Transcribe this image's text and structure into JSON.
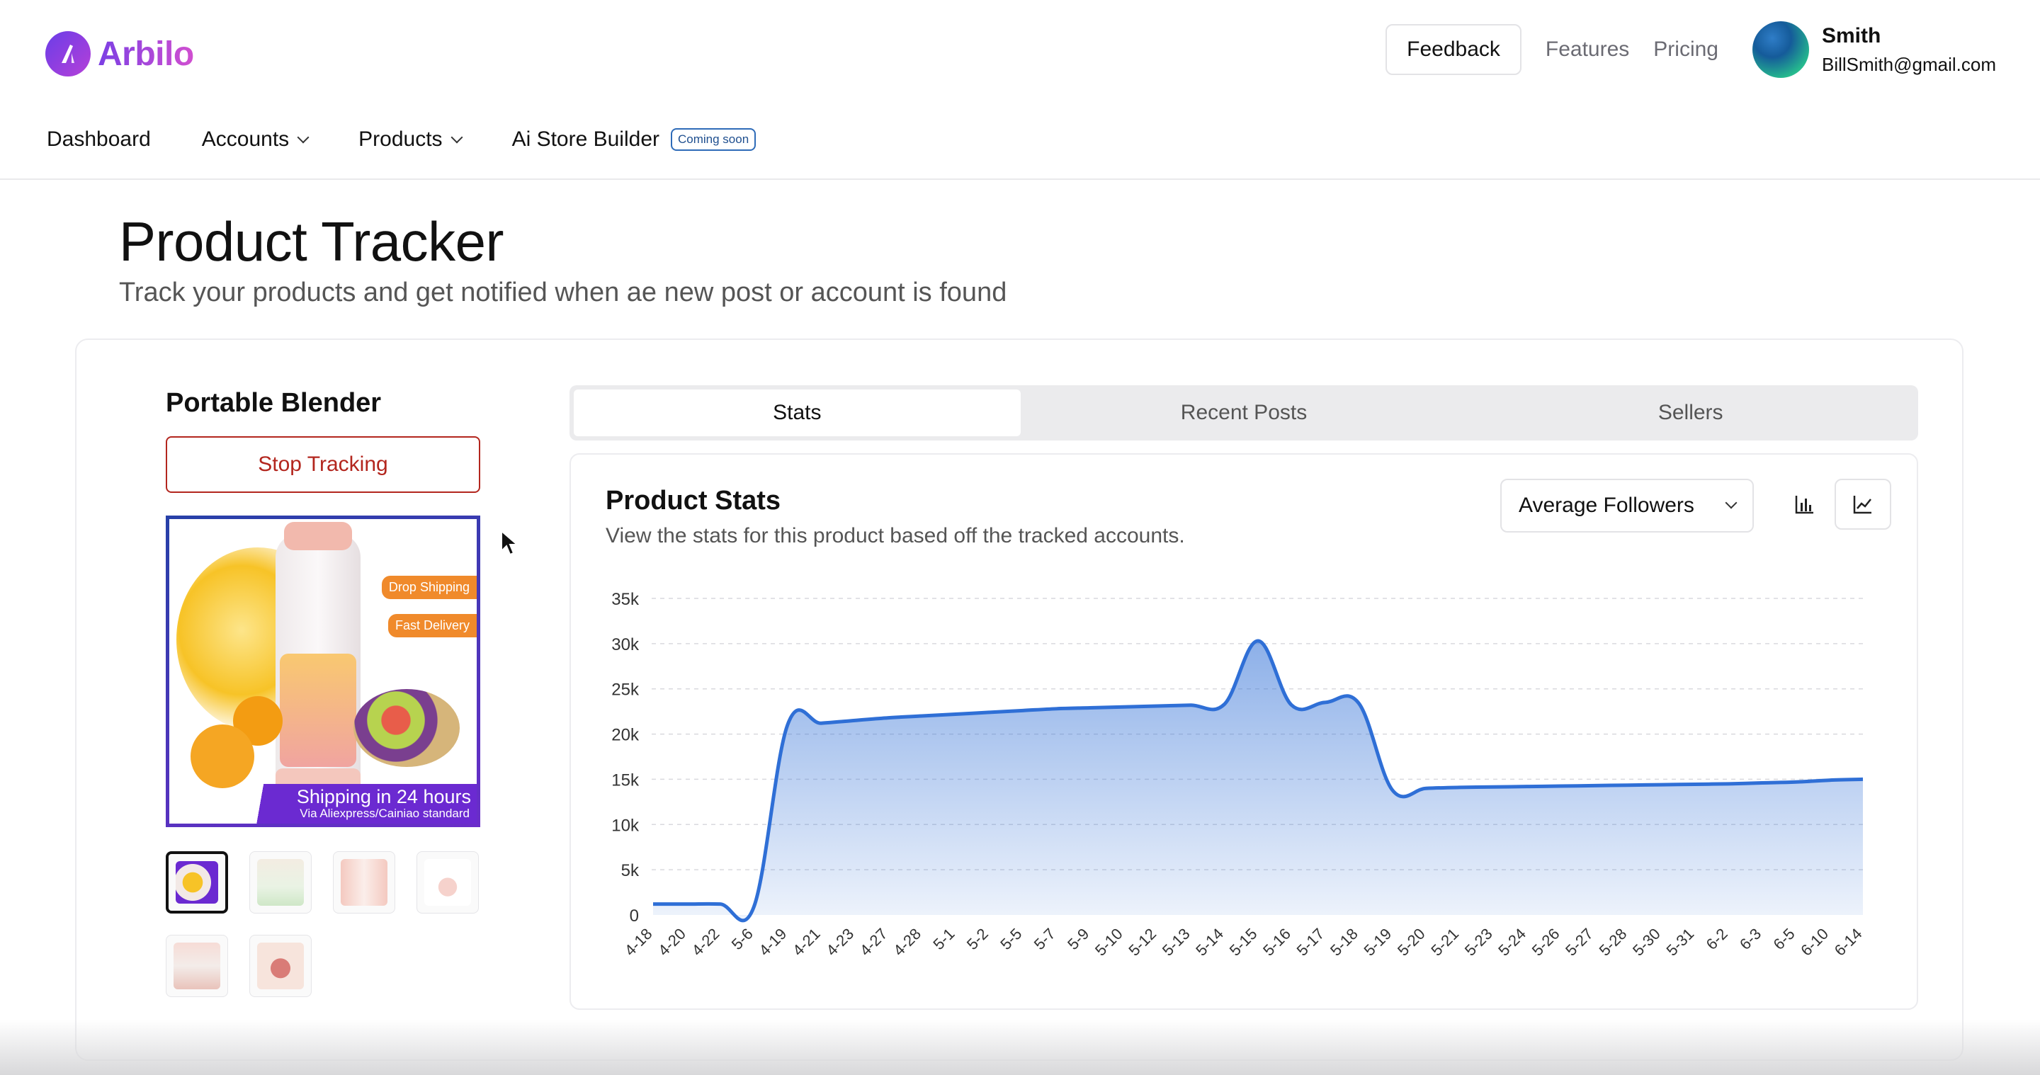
{
  "brand": {
    "name": "Arbilo",
    "accent": "#7b3fe4"
  },
  "header": {
    "feedback_label": "Feedback",
    "features_label": "Features",
    "pricing_label": "Pricing",
    "user_name": "Smith",
    "user_email": "BillSmith@gmail.com"
  },
  "nav": {
    "dashboard": "Dashboard",
    "accounts": "Accounts",
    "products": "Products",
    "ai_store_builder": "Ai Store Builder",
    "coming_soon_badge": "Coming soon"
  },
  "page": {
    "title": "Product Tracker",
    "subtitle": "Track your products and get notified when ae new post or account is found"
  },
  "product": {
    "name": "Portable Blender",
    "stop_label": "Stop Tracking",
    "image_tags": [
      "Drop Shipping",
      "Fast Delivery"
    ],
    "shipping_title": "Shipping in 24 hours",
    "shipping_sub": "Via Aliexpress/Cainiao standard",
    "thumbnail_count": 6
  },
  "tabs": [
    {
      "label": "Stats",
      "active": true
    },
    {
      "label": "Recent Posts",
      "active": false
    },
    {
      "label": "Sellers",
      "active": false
    }
  ],
  "stats": {
    "title": "Product Stats",
    "subtitle": "View the stats for this product based off the tracked accounts.",
    "metric_selected": "Average Followers",
    "bar_chart_icon": "bar-chart-icon",
    "line_chart_icon": "line-chart-icon"
  },
  "chart_data": {
    "type": "area",
    "title": "",
    "xlabel": "",
    "ylabel": "",
    "ylim": [
      0,
      35000
    ],
    "yticks": [
      0,
      5000,
      10000,
      15000,
      20000,
      25000,
      30000,
      35000
    ],
    "ytick_labels": [
      "0",
      "5k",
      "10k",
      "15k",
      "20k",
      "25k",
      "30k",
      "35k"
    ],
    "grid": true,
    "color": "#2f6fd6",
    "categories": [
      "4-18",
      "4-20",
      "4-22",
      "5-6",
      "4-19",
      "4-21",
      "4-23",
      "4-27",
      "4-28",
      "5-1",
      "5-2",
      "5-5",
      "5-7",
      "5-9",
      "5-10",
      "5-12",
      "5-13",
      "5-14",
      "5-15",
      "5-16",
      "5-17",
      "5-18",
      "5-19",
      "5-20",
      "5-21",
      "5-23",
      "5-24",
      "5-26",
      "5-27",
      "5-28",
      "5-30",
      "5-31",
      "6-2",
      "6-3",
      "6-5",
      "6-10",
      "6-14"
    ],
    "values": [
      1200,
      1200,
      1200,
      900,
      21000,
      21200,
      21500,
      21800,
      22000,
      22200,
      22400,
      22600,
      22800,
      22900,
      23000,
      23100,
      23200,
      23300,
      30300,
      23200,
      23500,
      23400,
      13800,
      14000,
      14100,
      14150,
      14200,
      14250,
      14300,
      14350,
      14400,
      14450,
      14500,
      14600,
      14700,
      14900,
      15000
    ]
  },
  "colors": {
    "danger": "#b3261e",
    "tab_bg": "#ebebed"
  }
}
